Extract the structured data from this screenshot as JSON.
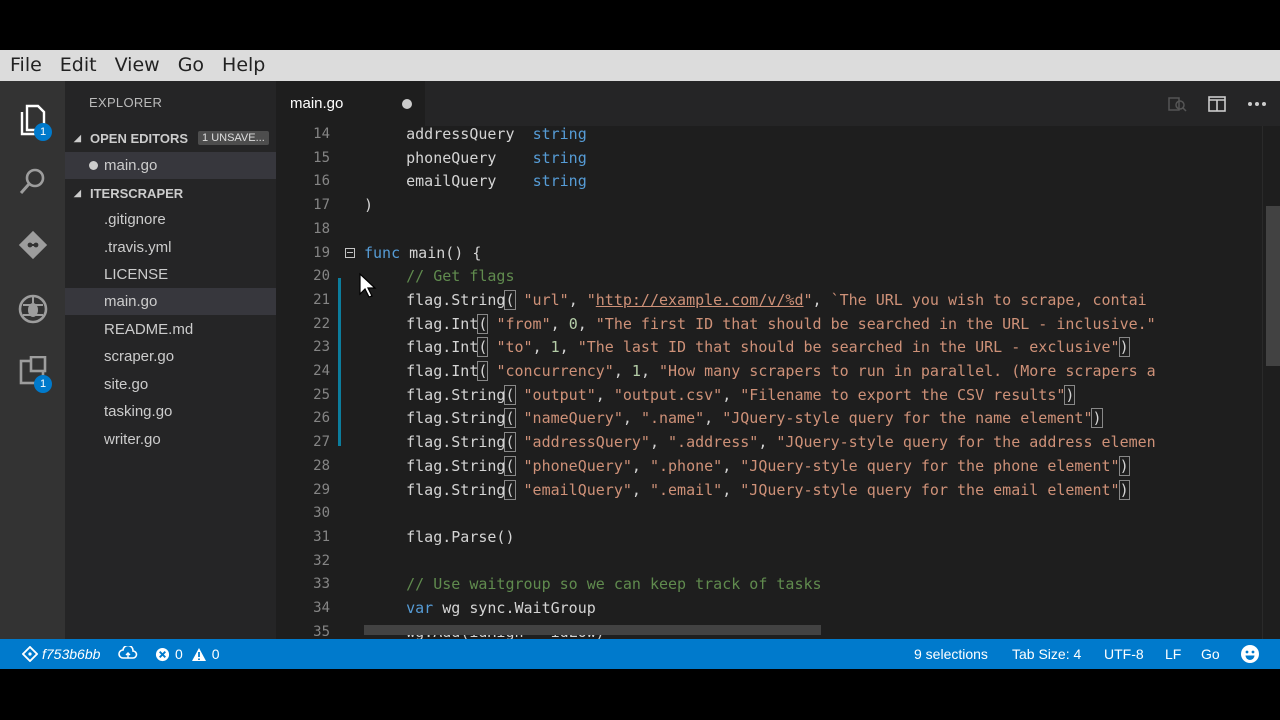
{
  "menu": [
    "File",
    "Edit",
    "View",
    "Go",
    "Help"
  ],
  "activity": {
    "explorer_badge": "1",
    "extensions_badge": "1"
  },
  "sidebar": {
    "title": "EXPLORER",
    "open_editors": {
      "label": "OPEN EDITORS",
      "badge": "1 UNSAVE...",
      "files": [
        "main.go"
      ]
    },
    "project": {
      "label": "ITERSCRAPER"
    },
    "files": [
      ".gitignore",
      ".travis.yml",
      "LICENSE",
      "main.go",
      "README.md",
      "scraper.go",
      "site.go",
      "tasking.go",
      "writer.go"
    ]
  },
  "tab": {
    "label": "main.go"
  },
  "editor": {
    "lines": [
      {
        "n": "14",
        "tokens": [
          [
            "    addressQuery  ",
            "fn"
          ],
          [
            "string",
            "kw"
          ]
        ]
      },
      {
        "n": "15",
        "tokens": [
          [
            "    phoneQuery    ",
            "fn"
          ],
          [
            "string",
            "kw"
          ]
        ]
      },
      {
        "n": "16",
        "tokens": [
          [
            "    emailQuery    ",
            "fn"
          ],
          [
            "string",
            "kw"
          ]
        ]
      },
      {
        "n": "17",
        "tokens": [
          [
            ")",
            "fn"
          ]
        ]
      },
      {
        "n": "18",
        "tokens": []
      },
      {
        "n": "19",
        "tokens": [
          [
            "func",
            "kw"
          ],
          [
            " main() {",
            "fn"
          ]
        ]
      },
      {
        "n": "20",
        "tokens": [
          [
            "    // Get flags",
            "cm"
          ]
        ]
      },
      {
        "n": "21",
        "tokens": [
          [
            "    flag.String",
            "fn"
          ],
          [
            "(",
            "br"
          ],
          [
            " ",
            "fn"
          ],
          [
            "\"url\"",
            "str"
          ],
          [
            ", ",
            "fn"
          ],
          [
            "\"",
            "str"
          ],
          [
            "http://example.com/v/%d",
            "url"
          ],
          [
            "\"",
            "str"
          ],
          [
            ", ",
            "fn"
          ],
          [
            "`The URL you wish to scrape, contai",
            "str"
          ]
        ]
      },
      {
        "n": "22",
        "tokens": [
          [
            "    flag.Int",
            "fn"
          ],
          [
            "(",
            "br"
          ],
          [
            " ",
            "fn"
          ],
          [
            "\"from\"",
            "str"
          ],
          [
            ", ",
            "fn"
          ],
          [
            "0",
            "num"
          ],
          [
            ", ",
            "fn"
          ],
          [
            "\"The first ID that should be searched in the URL - inclusive.\"",
            "str"
          ]
        ]
      },
      {
        "n": "23",
        "tokens": [
          [
            "    flag.Int",
            "fn"
          ],
          [
            "(",
            "br"
          ],
          [
            " ",
            "fn"
          ],
          [
            "\"to\"",
            "str"
          ],
          [
            ", ",
            "fn"
          ],
          [
            "1",
            "num"
          ],
          [
            ", ",
            "fn"
          ],
          [
            "\"The last ID that should be searched in the URL - exclusive\"",
            "str"
          ],
          [
            ")",
            "br"
          ]
        ]
      },
      {
        "n": "24",
        "tokens": [
          [
            "    flag.Int",
            "fn"
          ],
          [
            "(",
            "br"
          ],
          [
            " ",
            "fn"
          ],
          [
            "\"concurrency\"",
            "str"
          ],
          [
            ", ",
            "fn"
          ],
          [
            "1",
            "num"
          ],
          [
            ", ",
            "fn"
          ],
          [
            "\"How many scrapers to run in parallel. (More scrapers a",
            "str"
          ]
        ]
      },
      {
        "n": "25",
        "tokens": [
          [
            "    flag.String",
            "fn"
          ],
          [
            "(",
            "br"
          ],
          [
            " ",
            "fn"
          ],
          [
            "\"output\"",
            "str"
          ],
          [
            ", ",
            "fn"
          ],
          [
            "\"output.csv\"",
            "str"
          ],
          [
            ", ",
            "fn"
          ],
          [
            "\"Filename to export the CSV results\"",
            "str"
          ],
          [
            ")",
            "br"
          ]
        ]
      },
      {
        "n": "26",
        "tokens": [
          [
            "    flag.String",
            "fn"
          ],
          [
            "(",
            "br"
          ],
          [
            " ",
            "fn"
          ],
          [
            "\"nameQuery\"",
            "str"
          ],
          [
            ", ",
            "fn"
          ],
          [
            "\".name\"",
            "str"
          ],
          [
            ", ",
            "fn"
          ],
          [
            "\"JQuery-style query for the name element\"",
            "str"
          ],
          [
            ")",
            "br"
          ]
        ]
      },
      {
        "n": "27",
        "tokens": [
          [
            "    flag.String",
            "fn"
          ],
          [
            "(",
            "br"
          ],
          [
            " ",
            "fn"
          ],
          [
            "\"addressQuery\"",
            "str"
          ],
          [
            ", ",
            "fn"
          ],
          [
            "\".address\"",
            "str"
          ],
          [
            ", ",
            "fn"
          ],
          [
            "\"JQuery-style query for the address elemen",
            "str"
          ]
        ]
      },
      {
        "n": "28",
        "tokens": [
          [
            "    flag.String",
            "fn"
          ],
          [
            "(",
            "br"
          ],
          [
            " ",
            "fn"
          ],
          [
            "\"phoneQuery\"",
            "str"
          ],
          [
            ", ",
            "fn"
          ],
          [
            "\".phone\"",
            "str"
          ],
          [
            ", ",
            "fn"
          ],
          [
            "\"JQuery-style query for the phone element\"",
            "str"
          ],
          [
            ")",
            "br"
          ]
        ]
      },
      {
        "n": "29",
        "tokens": [
          [
            "    flag.String",
            "fn"
          ],
          [
            "(",
            "br"
          ],
          [
            " ",
            "fn"
          ],
          [
            "\"emailQuery\"",
            "str"
          ],
          [
            ", ",
            "fn"
          ],
          [
            "\".email\"",
            "str"
          ],
          [
            ", ",
            "fn"
          ],
          [
            "\"JQuery-style query for the email element\"",
            "str"
          ],
          [
            ")",
            "br"
          ]
        ]
      },
      {
        "n": "30",
        "tokens": []
      },
      {
        "n": "31",
        "tokens": [
          [
            "    flag.Parse()",
            "fn"
          ]
        ]
      },
      {
        "n": "32",
        "tokens": []
      },
      {
        "n": "33",
        "tokens": [
          [
            "    // Use waitgroup so we can keep track of tasks",
            "cm"
          ]
        ]
      },
      {
        "n": "34",
        "tokens": [
          [
            "    ",
            "fn"
          ],
          [
            "var",
            "kw"
          ],
          [
            " wg sync.WaitGroup",
            "fn"
          ]
        ]
      },
      {
        "n": "35",
        "tokens": [
          [
            "    wg.Add(idHigh - idLow)",
            "fn"
          ]
        ]
      }
    ]
  },
  "status": {
    "branch": "f753b6bb",
    "errors": "0",
    "warnings": "0",
    "selections": "9 selections",
    "tab_size": "Tab Size: 4",
    "encoding": "UTF-8",
    "eol": "LF",
    "language": "Go"
  },
  "colors": {
    "accent": "#007acc",
    "keyword": "#569cd6",
    "string": "#ce9178",
    "comment": "#608b4e",
    "number": "#b5cea8"
  }
}
